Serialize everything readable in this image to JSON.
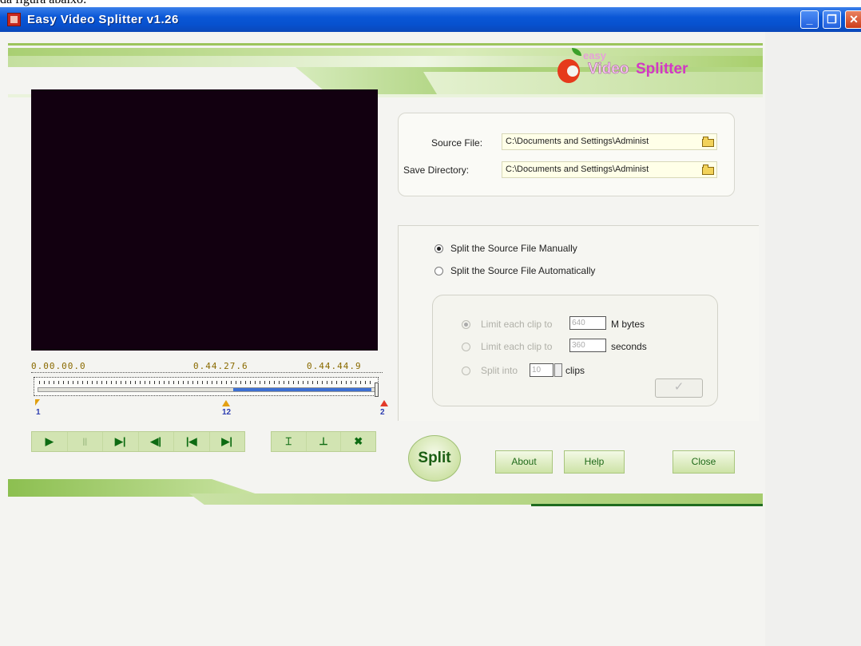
{
  "caption": "da figura abaixo:",
  "window": {
    "title": "Easy Video Splitter v1.26",
    "buttons": {
      "minimize": "_",
      "restore": "❐",
      "close": "✕"
    }
  },
  "logo": {
    "easy": "easy",
    "video": "Video",
    "splitter": "Splitter"
  },
  "timeline": {
    "start": "0.00.00.0",
    "mid": "0.44.27.6",
    "end": "0.44.44.9",
    "markers": [
      "1",
      "12",
      "2"
    ],
    "selection": {
      "from": 0.577,
      "to": 0.987
    }
  },
  "controls": [
    {
      "name": "play-icon",
      "glyph": "▶"
    },
    {
      "name": "pause-icon",
      "glyph": "‖"
    },
    {
      "name": "step-forward-icon",
      "glyph": "▶|"
    },
    {
      "name": "step-back-icon",
      "glyph": "◀|"
    },
    {
      "name": "go-start-icon",
      "glyph": "|◀"
    },
    {
      "name": "go-end-icon",
      "glyph": "▶|"
    }
  ],
  "tools": [
    {
      "name": "add-marker-icon",
      "glyph": "⌶"
    },
    {
      "name": "ruler-icon",
      "glyph": "⊥"
    },
    {
      "name": "delete-marker-icon",
      "glyph": "✖"
    }
  ],
  "source": {
    "source_label": "Source File:",
    "source_value": "C:\\Documents and Settings\\Administ",
    "save_label": "Save Directory:",
    "save_value": "C:\\Documents and Settings\\Administ"
  },
  "split_mode": {
    "manual": "Split the Source File Manually",
    "auto": "Split the Source File Automatically",
    "selected": "manual"
  },
  "auto_options": {
    "limit_size_label": "Limit each clip to",
    "limit_size_value": "640",
    "limit_size_unit": "M bytes",
    "limit_time_label": "Limit each clip to",
    "limit_time_value": "360",
    "limit_time_unit": "seconds",
    "split_into_label": "Split into",
    "split_into_value": "10",
    "split_into_unit": "clips",
    "apply": "✓"
  },
  "buttons": {
    "split": "Split",
    "about": "About",
    "help": "Help",
    "close": "Close"
  },
  "colors": {
    "accent_green": "#1f6a18",
    "titlebar_blue": "#0751cf",
    "logo_magenta": "#d238c5"
  }
}
